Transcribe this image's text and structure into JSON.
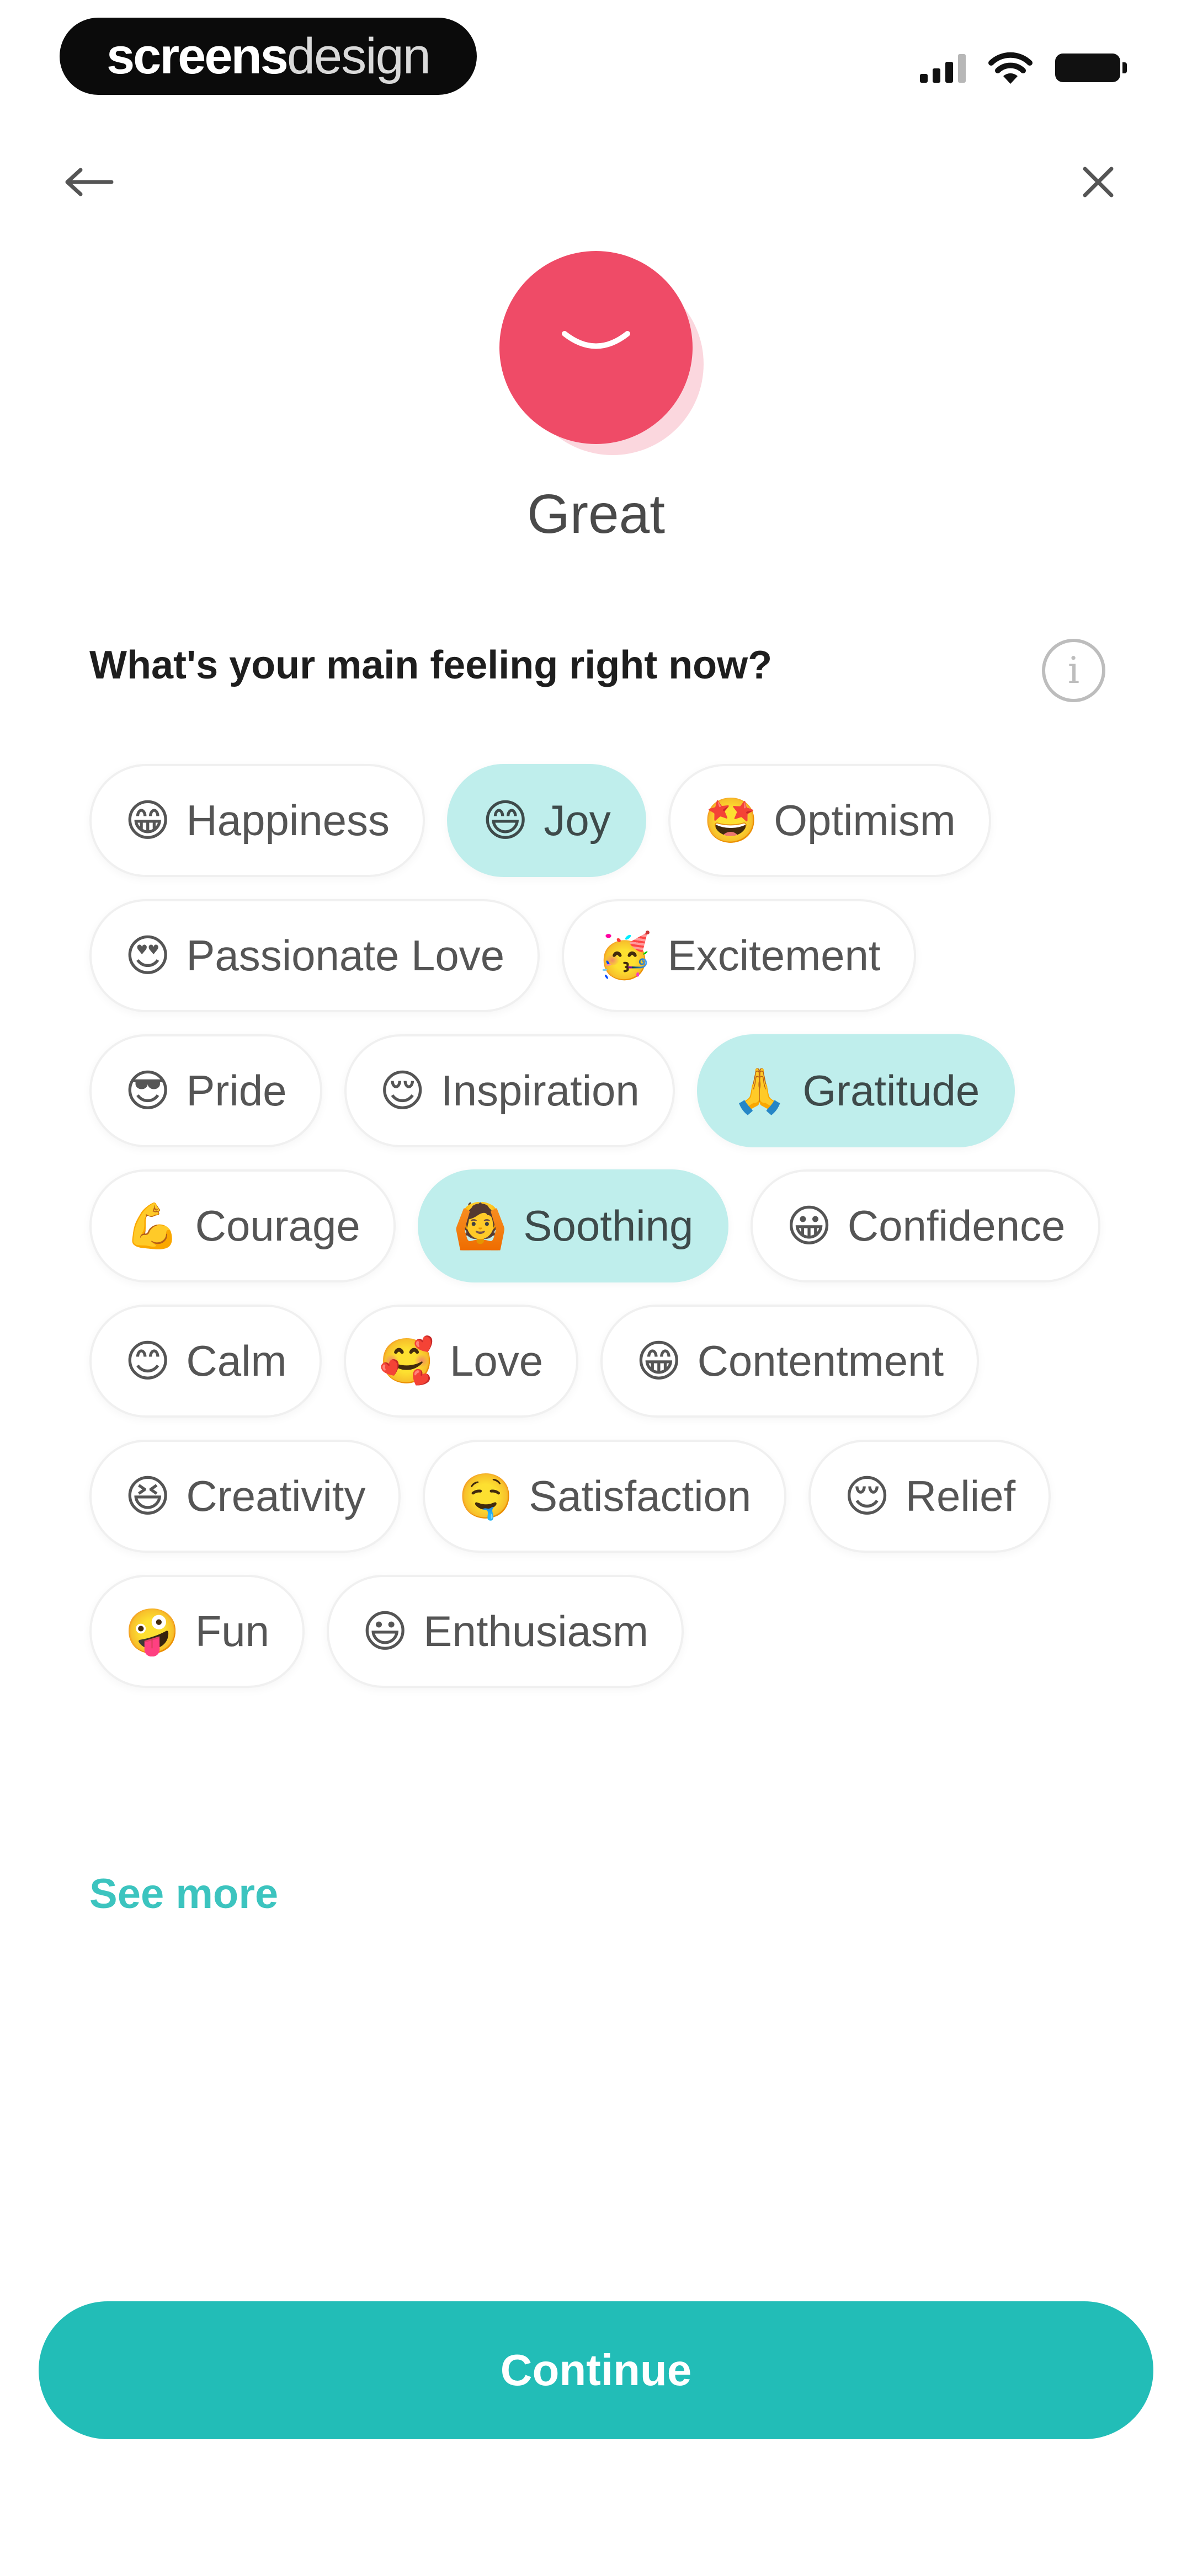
{
  "status_bar": {
    "brand_bold": "screens",
    "brand_light": "design"
  },
  "nav": {
    "back_icon": "arrow-left-icon",
    "close_icon": "close-icon"
  },
  "mood": {
    "label": "Great",
    "color": "#ef4b67"
  },
  "question": {
    "text": "What's your main feeling right now?",
    "info_icon": "info-icon"
  },
  "chips": [
    {
      "emoji": "😁",
      "label": "Happiness",
      "selected": false
    },
    {
      "emoji": "😄",
      "label": "Joy",
      "selected": true
    },
    {
      "emoji": "🤩",
      "label": "Optimism",
      "selected": false
    },
    {
      "emoji": "😍",
      "label": "Passionate Love",
      "selected": false
    },
    {
      "emoji": "🥳",
      "label": "Excitement",
      "selected": false
    },
    {
      "emoji": "😎",
      "label": "Pride",
      "selected": false
    },
    {
      "emoji": "😌",
      "label": "Inspiration",
      "selected": false
    },
    {
      "emoji": "🙏",
      "label": "Gratitude",
      "selected": true
    },
    {
      "emoji": "💪",
      "label": "Courage",
      "selected": false
    },
    {
      "emoji": "🙆",
      "label": "Soothing",
      "selected": true
    },
    {
      "emoji": "😀",
      "label": "Confidence",
      "selected": false
    },
    {
      "emoji": "😊",
      "label": "Calm",
      "selected": false
    },
    {
      "emoji": "🥰",
      "label": "Love",
      "selected": false
    },
    {
      "emoji": "😁",
      "label": "Contentment",
      "selected": false
    },
    {
      "emoji": "😆",
      "label": "Creativity",
      "selected": false
    },
    {
      "emoji": "🤤",
      "label": "Satisfaction",
      "selected": false
    },
    {
      "emoji": "😌",
      "label": "Relief",
      "selected": false
    },
    {
      "emoji": "🤪",
      "label": "Fun",
      "selected": false
    },
    {
      "emoji": "😃",
      "label": "Enthusiasm",
      "selected": false
    }
  ],
  "see_more": "See more",
  "continue_label": "Continue",
  "colors": {
    "accent": "#22bdb7",
    "chip_selected": "#bfeeec",
    "link": "#3cc4bf"
  }
}
